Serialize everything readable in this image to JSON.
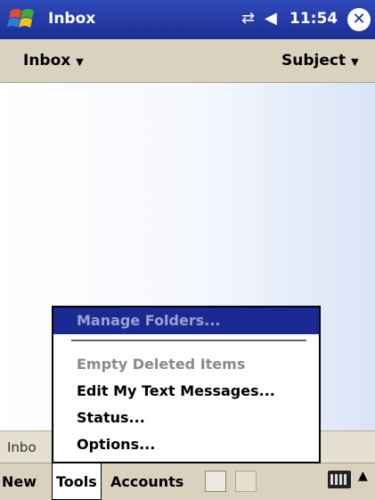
{
  "titlebar": {
    "title": "Inbox",
    "time": "11:54",
    "icons": [
      "start-logo-icon",
      "connectivity-icon",
      "speaker-icon",
      "close-icon"
    ],
    "close_glyph": "✕"
  },
  "header": {
    "folder_label": "Inbox",
    "sort_label": "Subject"
  },
  "list": {
    "status_text": "Inbo"
  },
  "tools_menu": {
    "items": [
      {
        "label": "Manage Folders...",
        "state": "selected"
      },
      {
        "label": "Empty Deleted Items",
        "state": "disabled"
      },
      {
        "label": "Edit My Text Messages...",
        "state": "enabled"
      },
      {
        "label": "Status...",
        "state": "enabled"
      },
      {
        "label": "Options...",
        "state": "enabled"
      }
    ]
  },
  "menubar": {
    "new_label": "New",
    "tools_label": "Tools",
    "accounts_label": "Accounts",
    "icons": [
      "send-receive-icon",
      "attachment-icon",
      "keyboard-icon",
      "input-up-arrow-icon"
    ]
  },
  "colors": {
    "title_bg": "#1b2f93",
    "bar_bg": "#d9d2bf",
    "selection": "#1a2a92"
  }
}
